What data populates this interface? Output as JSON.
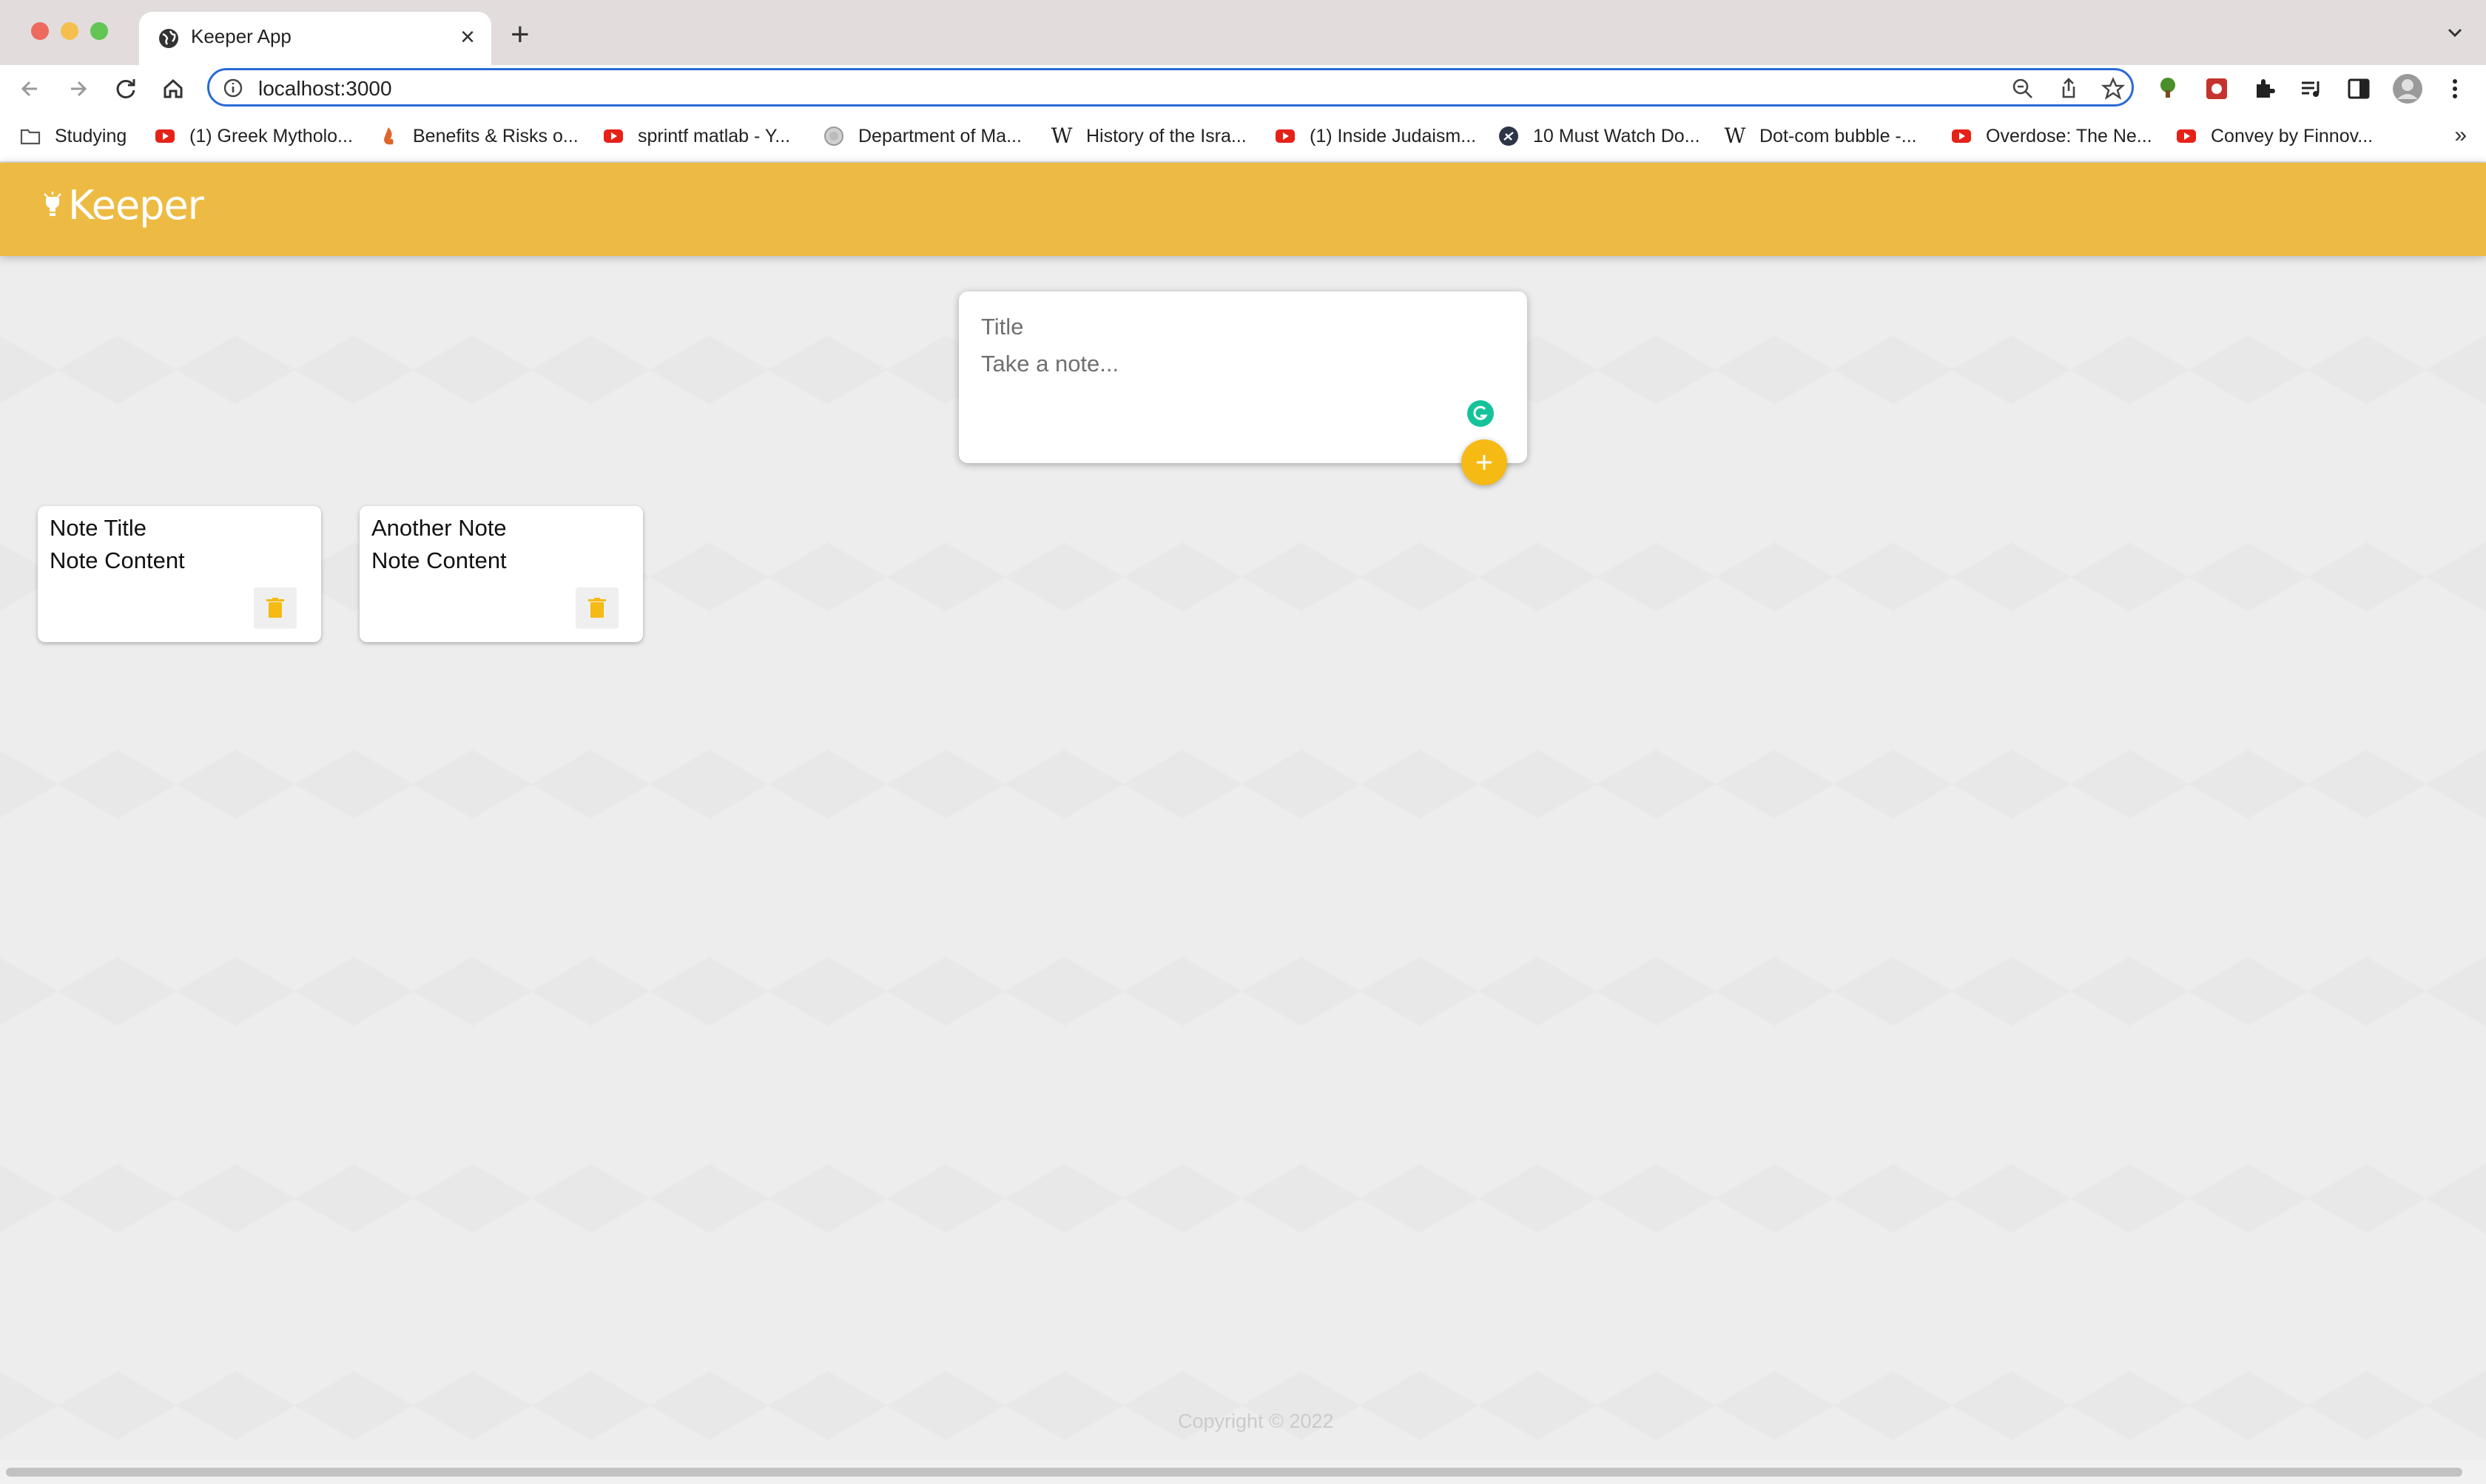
{
  "browser": {
    "tab": {
      "title": "Keeper App"
    },
    "address_bar": {
      "url": "localhost:3000"
    },
    "bookmarks": [
      {
        "label": "Studying",
        "icon": "folder-icon"
      },
      {
        "label": "(1) Greek Mytholo...",
        "icon": "youtube-icon"
      },
      {
        "label": "Benefits & Risks o...",
        "icon": "flame-icon"
      },
      {
        "label": "sprintf matlab - Y...",
        "icon": "youtube-icon"
      },
      {
        "label": "Department of Ma...",
        "icon": "seal-icon"
      },
      {
        "label": "History of the Isra...",
        "icon": "wikipedia-icon"
      },
      {
        "label": "(1) Inside Judaism...",
        "icon": "youtube-icon"
      },
      {
        "label": "10 Must Watch Do...",
        "icon": "site-icon"
      },
      {
        "label": "Dot-com bubble -...",
        "icon": "wikipedia-icon"
      },
      {
        "label": "Overdose: The Ne...",
        "icon": "youtube-icon"
      },
      {
        "label": "Convey by Finnov...",
        "icon": "youtube-icon"
      }
    ],
    "bookmarks_overflow": "»"
  },
  "app": {
    "brand": "Keeper",
    "create_area": {
      "title_placeholder": "Title",
      "content_placeholder": "Take a note..."
    },
    "notes": [
      {
        "title": "Note Title",
        "content": "Note Content"
      },
      {
        "title": "Another Note",
        "content": "Note Content"
      }
    ],
    "footer": "Copyright © 2022"
  },
  "colors": {
    "header": "#edbb43",
    "accent": "#f5ba13",
    "page_background": "#ededed",
    "omnibox_border": "#2a6ad6"
  }
}
